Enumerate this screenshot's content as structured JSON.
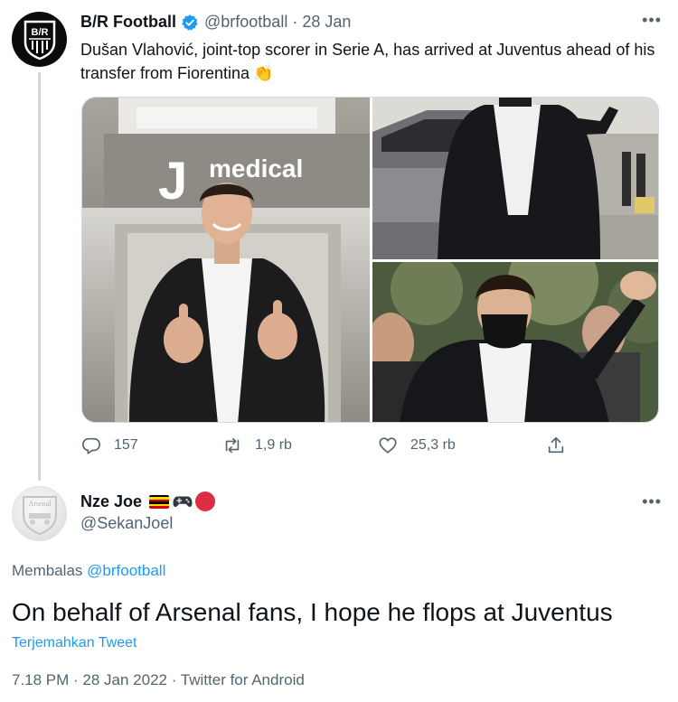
{
  "tweet": {
    "author_name": "B/R Football",
    "avatar_text": "B/R",
    "handle": "@brfootball",
    "separator": "·",
    "date": "28 Jan",
    "more_label": "•••",
    "text": "Dušan Vlahović, joint-top scorer in Serie A, has arrived at Juventus ahead of his transfer from Fiorentina",
    "emoji": "👏",
    "media_sign_text": "medical",
    "media_sign_logo": "J",
    "stats": {
      "replies": "157",
      "retweets": "1,9 rb",
      "likes": "25,3 rb"
    }
  },
  "reply": {
    "author_name": "Nze Joe",
    "avatar_text": "Arsenal",
    "handle": "@SekanJoel",
    "more_label": "•••",
    "replying_prefix": "Membalas",
    "replying_to": "@brfootball",
    "text": "On behalf of Arsenal fans, I hope he flops at Juventus",
    "translate_label": "Terjemahkan Tweet",
    "meta": "7.18 PM · 28 Jan 2022 · Twitter for Android"
  },
  "colors": {
    "accent": "#1d9bf0",
    "secondary_text": "#536471",
    "thread_line": "#cfd9de"
  }
}
